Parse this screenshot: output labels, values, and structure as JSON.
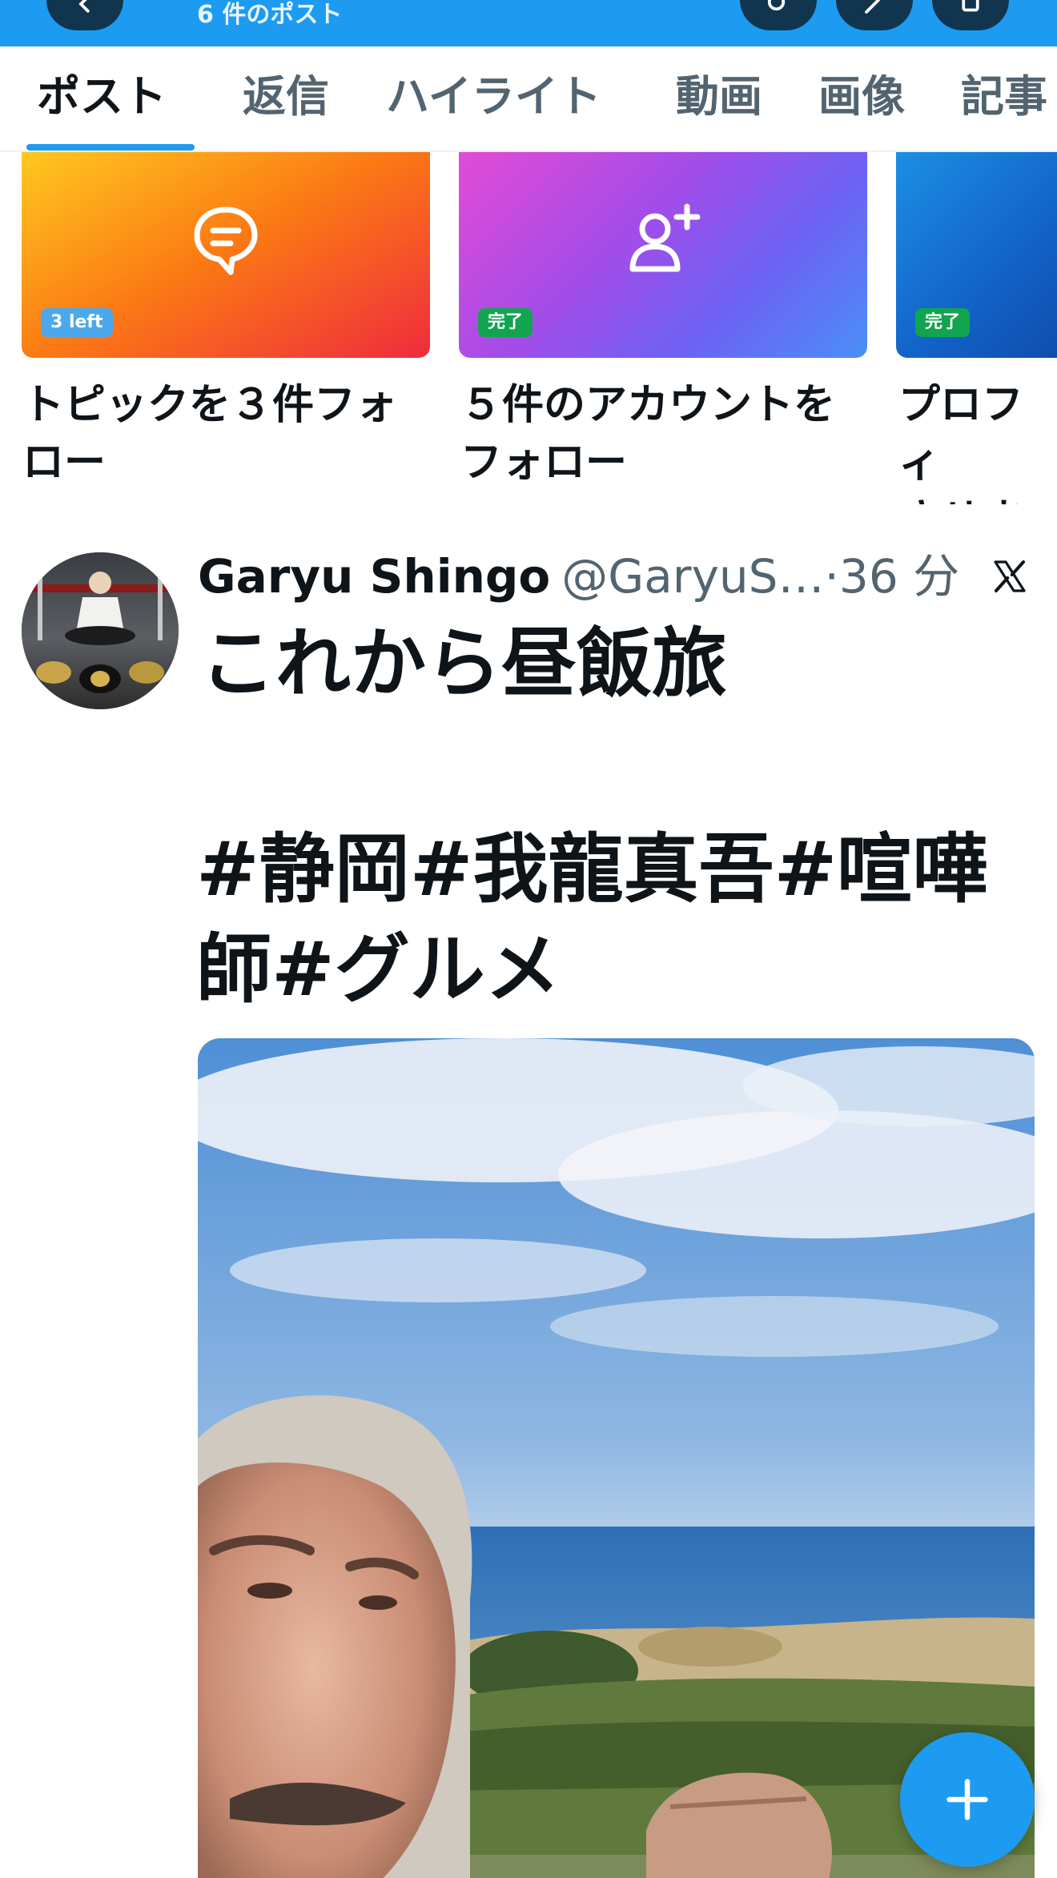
{
  "header": {
    "subtitle": "6 件のポスト",
    "accent_color": "#1d9bf0",
    "icons": [
      "back-arrow-icon",
      "search-icon",
      "compose-icon",
      "share-icon"
    ]
  },
  "tabs": [
    {
      "label": "ポスト",
      "active": true
    },
    {
      "label": "返信"
    },
    {
      "label": "ハイライト"
    },
    {
      "label": "動画"
    },
    {
      "label": "画像"
    },
    {
      "label": "記事"
    }
  ],
  "cards": [
    {
      "badge": "3 left",
      "title": "トピックを３件フォ\nロー",
      "icon": "chat-bubble-icon"
    },
    {
      "badge": "完了",
      "title": "５件のアカウントを\nフォロー",
      "icon": "add-user-icon"
    },
    {
      "badge": "完了",
      "title": "プロフィ\nさせまし"
    }
  ],
  "post": {
    "name": "Garyu Shingo",
    "handle": "@GaryuS…",
    "separator": "·",
    "time": "36 分",
    "line1": "これから昼飯旅",
    "hashtags": "#静岡#我龍真吾#喧嘩師#グルメ",
    "source_icon": "x-logo-icon"
  },
  "fab": {
    "icon": "plus-icon"
  }
}
